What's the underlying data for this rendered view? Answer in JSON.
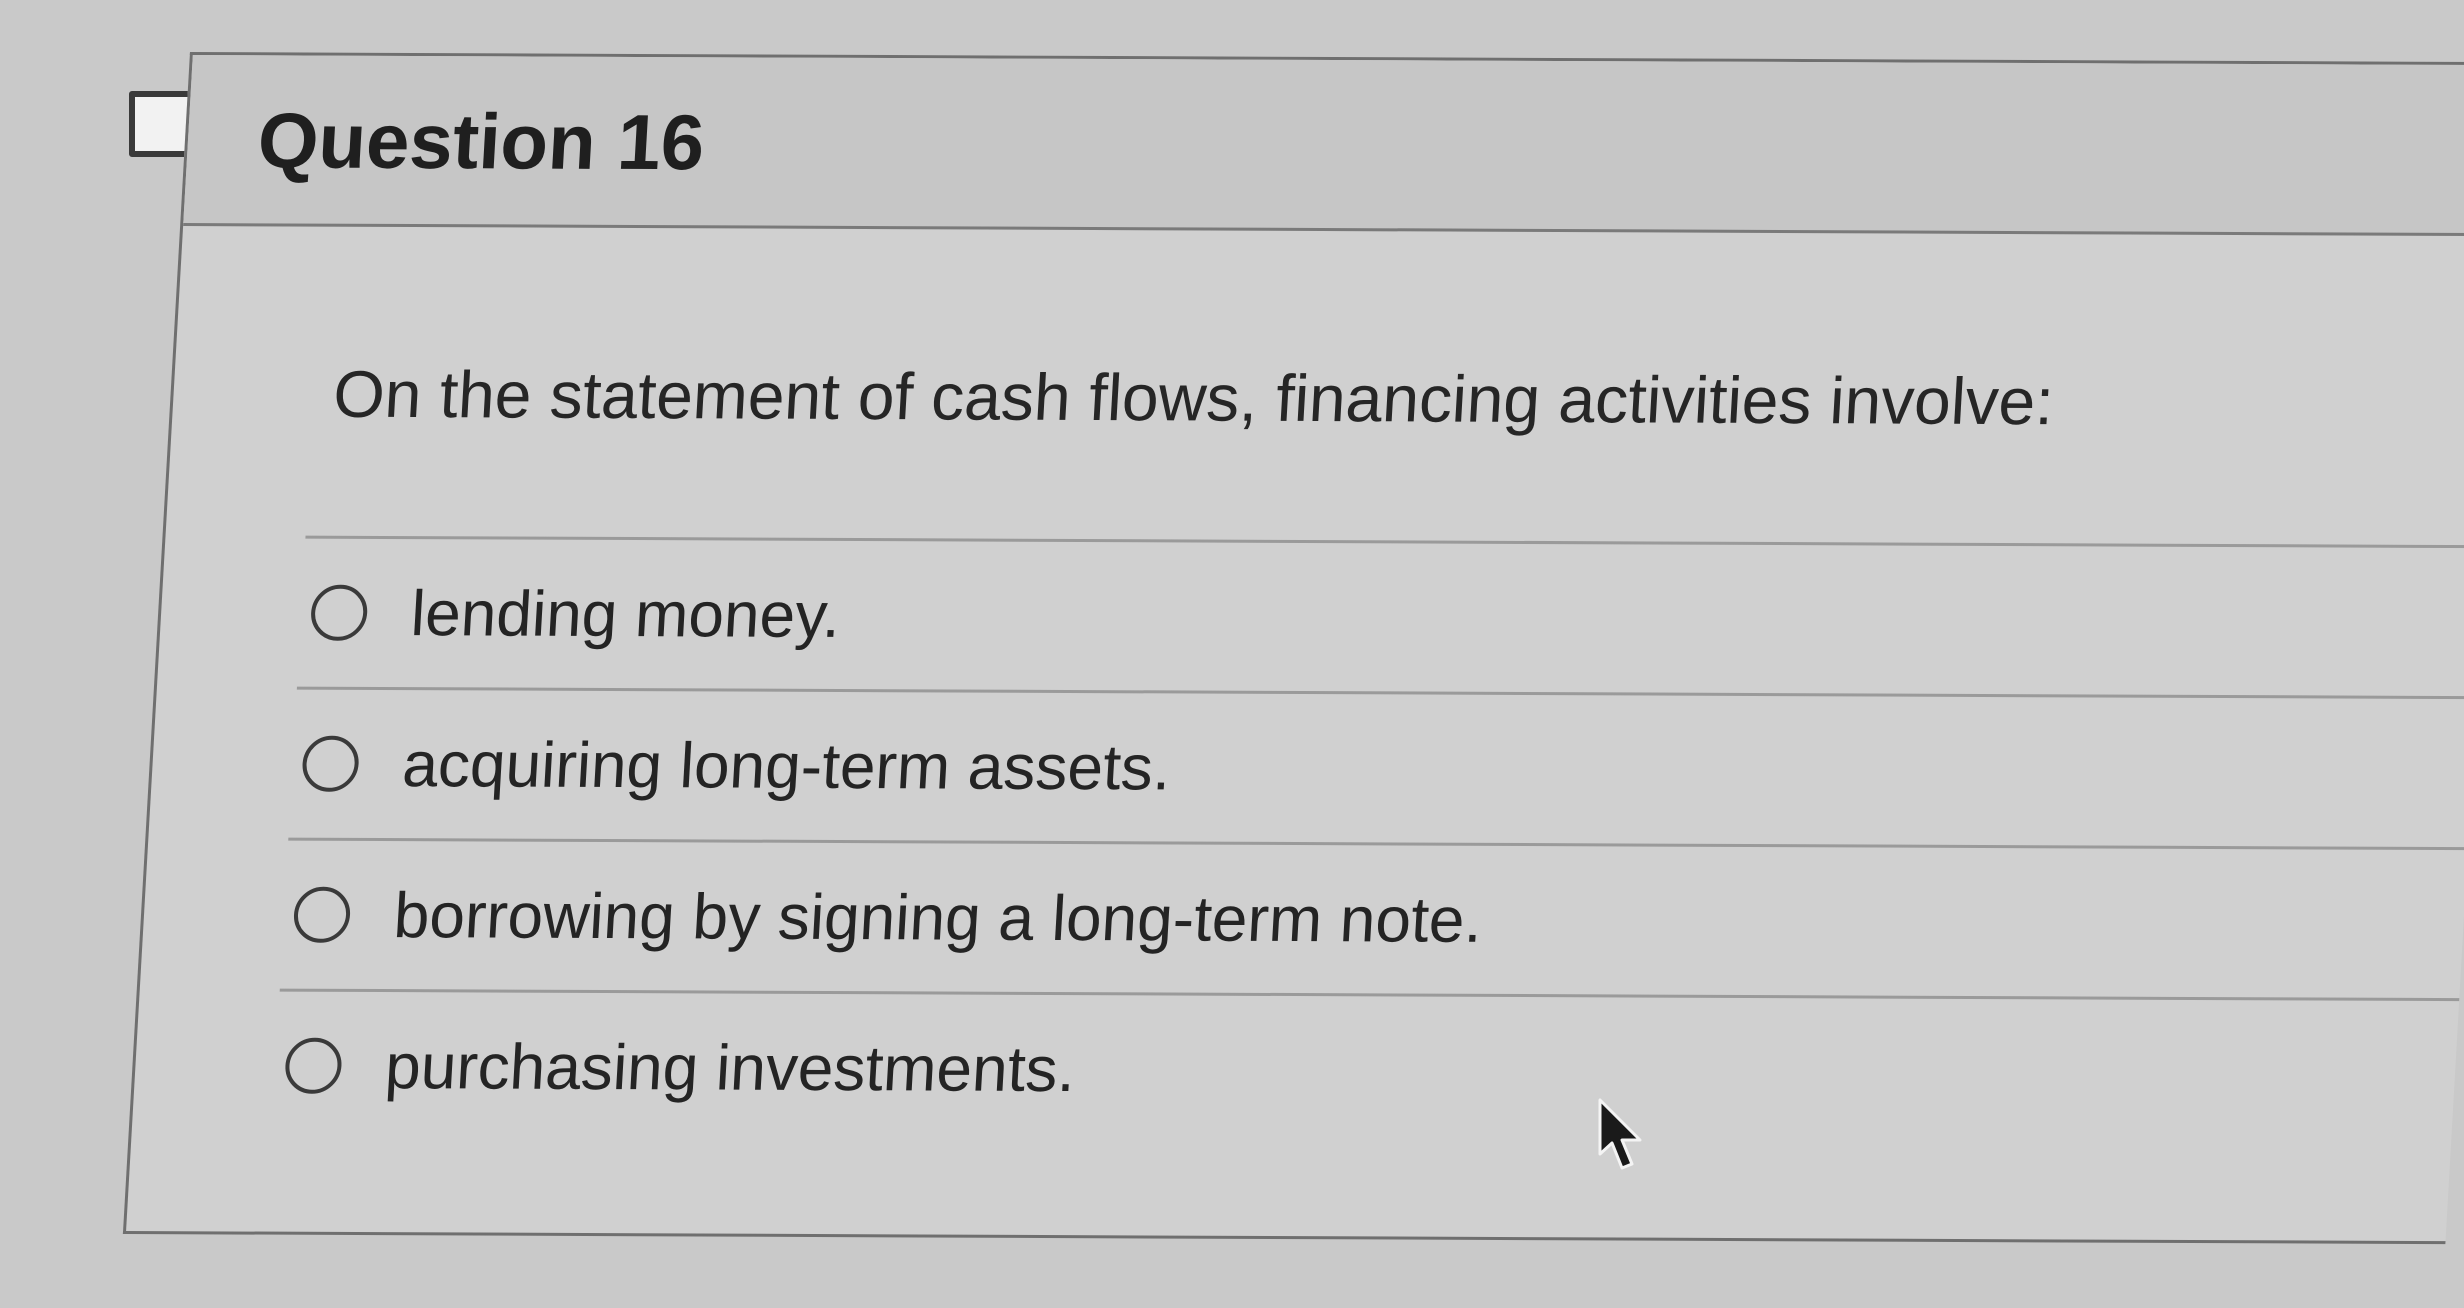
{
  "question": {
    "title": "Question 16",
    "prompt": "On the statement of cash flows, financing activities involve:"
  },
  "answers": [
    {
      "label": "lending money."
    },
    {
      "label": "acquiring long-term assets."
    },
    {
      "label": "borrowing by signing a long-term note."
    },
    {
      "label": "purchasing investments."
    }
  ],
  "icons": {
    "flag": "flag-icon",
    "radio": "radio-unchecked-icon",
    "cursor": "mouse-pointer-icon"
  },
  "colors": {
    "background": "#c9c9c9",
    "card": "#d0d0d0",
    "header": "#c6c6c6",
    "border": "#6f6f6f",
    "text": "#242424"
  }
}
